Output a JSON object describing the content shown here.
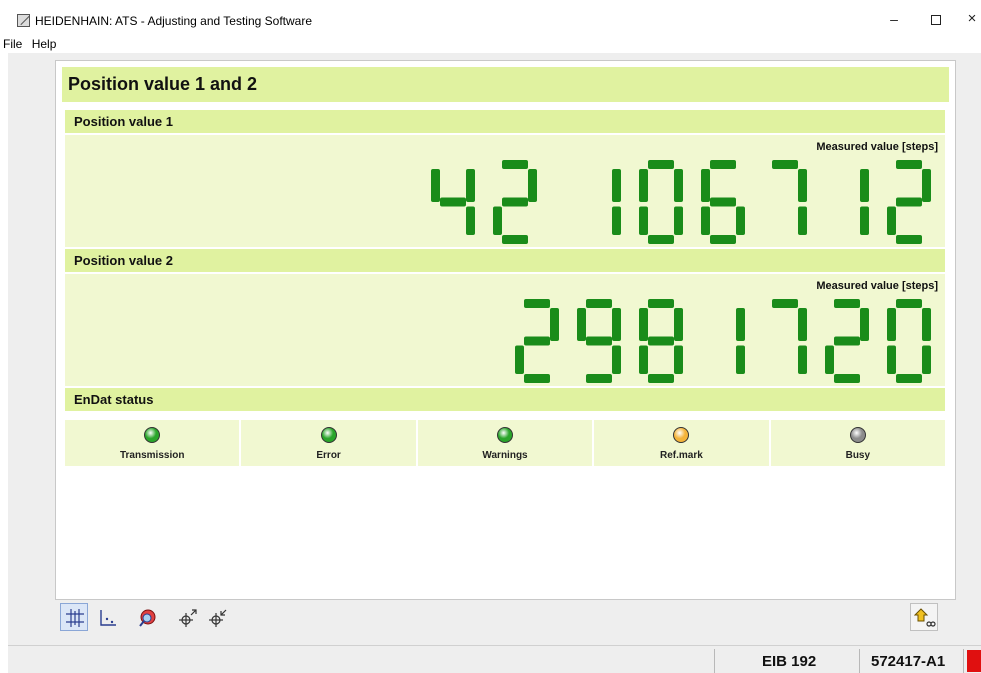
{
  "window": {
    "title": "HEIDENHAIN: ATS - Adjusting and Testing Software",
    "minimize": "–",
    "maximize": "",
    "close": "×"
  },
  "menu": [
    "File",
    "Help"
  ],
  "panel": {
    "title": "Position value 1 and 2",
    "position1": {
      "title": "Position value 1",
      "measured_label": "Measured value [steps]",
      "value": "42 106712"
    },
    "position2": {
      "title": "Position value 2",
      "measured_label": "Measured value [steps]",
      "value": "2981720"
    },
    "endat": {
      "title": "EnDat status",
      "indicators": [
        {
          "label": "Transmission",
          "state": "ok",
          "color": "#2aa52a"
        },
        {
          "label": "Error",
          "state": "ok",
          "color": "#2aa52a"
        },
        {
          "label": "Warnings",
          "state": "ok",
          "color": "#2aa52a"
        },
        {
          "label": "Ref.mark",
          "state": "warning",
          "color": "#f4b43a"
        },
        {
          "label": "Busy",
          "state": "off",
          "color": "#8c8c8c"
        }
      ]
    }
  },
  "toolbar": {
    "buttons": [
      {
        "icon": "grid-icon",
        "active": true
      },
      {
        "icon": "axis-icon",
        "active": false
      },
      {
        "icon": "zoom-magnifier-icon",
        "active": false
      },
      {
        "icon": "crosshair-arrow-out-icon",
        "active": false
      },
      {
        "icon": "crosshair-arrow-in-icon",
        "active": false
      }
    ],
    "right_button": {
      "icon": "exit-arrow-icon"
    }
  },
  "statusbar": {
    "device": "EIB 192",
    "id": "572417-A1"
  },
  "colors": {
    "lcd": "#1a8c1a",
    "header": "#e0f2a0",
    "section_bg": "#f1f8d1"
  }
}
